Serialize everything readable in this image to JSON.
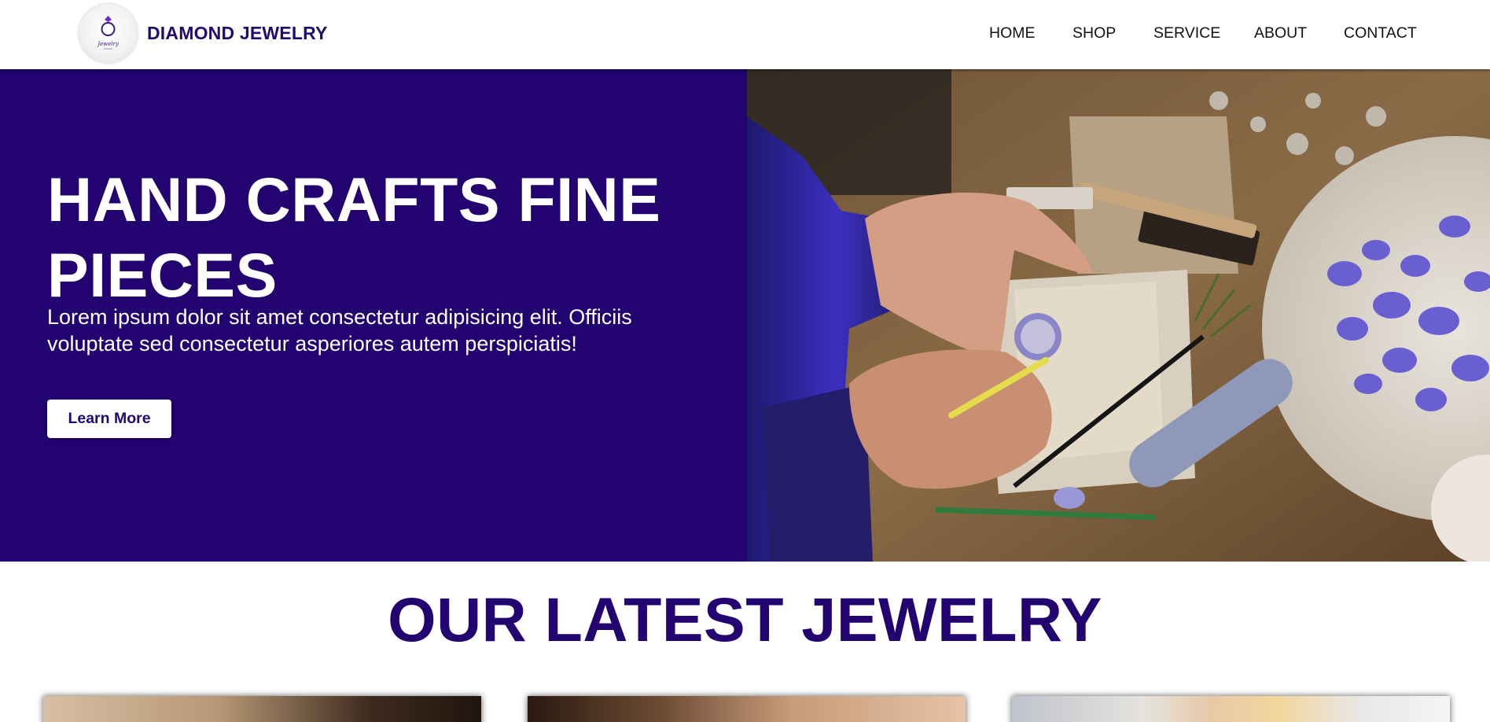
{
  "header": {
    "brand": "DIAMOND JEWELRY",
    "logo_text": "Jewelry",
    "nav": [
      "HOME",
      "SHOP",
      "SERVICE",
      "ABOUT",
      "CONTACT"
    ]
  },
  "hero": {
    "title": "HAND CRAFTS FINE PIECES",
    "text": "Lorem ipsum dolor sit amet consectetur adipisicing elit. Officiis voluptate sed consectetur asperiores autem perspiciatis!",
    "button_label": "Learn More",
    "image_icon": "jewelry-workshop-photo"
  },
  "latest": {
    "title": "OUR LATEST JEWELRY",
    "cards": [
      "jewelry-photo-1",
      "jewelry-photo-2",
      "jewelry-photo-3"
    ]
  },
  "colors": {
    "brand": "#220b6e",
    "hero_background": "#220370",
    "white": "#ffffff"
  }
}
